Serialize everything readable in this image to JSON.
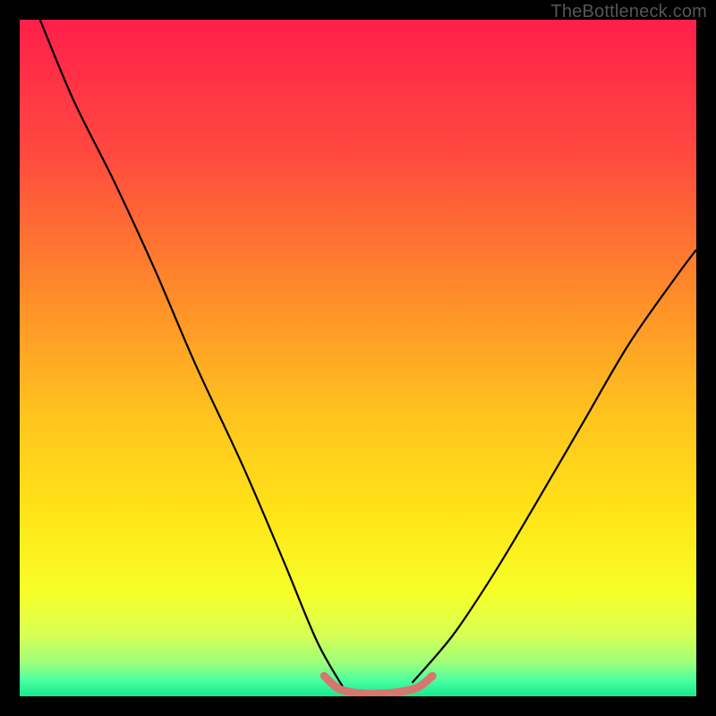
{
  "watermark": "TheBottleneck.com",
  "chart_data": {
    "type": "line",
    "title": "",
    "xlabel": "",
    "ylabel": "",
    "xlim": [
      0,
      100
    ],
    "ylim": [
      0,
      100
    ],
    "series": [
      {
        "name": "left-curve",
        "x": [
          3,
          8,
          14,
          20,
          26,
          33,
          39,
          44,
          48
        ],
        "values": [
          100,
          88,
          76,
          63,
          49,
          34,
          20,
          8,
          1
        ]
      },
      {
        "name": "right-curve",
        "x": [
          58,
          64,
          70,
          76,
          83,
          90,
          97,
          100
        ],
        "values": [
          2,
          9,
          18,
          28,
          40,
          52,
          62,
          66
        ]
      },
      {
        "name": "bottom-band-outline",
        "x": [
          45,
          47,
          49,
          51,
          53,
          55,
          57,
          59,
          61
        ],
        "values": [
          3,
          1.2,
          0.6,
          0.4,
          0.4,
          0.5,
          0.8,
          1.4,
          3
        ]
      }
    ],
    "legend": null,
    "grid": false
  },
  "gradient_stops": [
    {
      "offset": 0.0,
      "color": "#ff1f4a"
    },
    {
      "offset": 0.2,
      "color": "#ff4a3f"
    },
    {
      "offset": 0.4,
      "color": "#ff8a2a"
    },
    {
      "offset": 0.58,
      "color": "#ffc21e"
    },
    {
      "offset": 0.74,
      "color": "#ffe617"
    },
    {
      "offset": 0.85,
      "color": "#f6ff2a"
    },
    {
      "offset": 0.91,
      "color": "#d6ff55"
    },
    {
      "offset": 0.95,
      "color": "#9dff7a"
    },
    {
      "offset": 0.976,
      "color": "#4dffa0"
    },
    {
      "offset": 1.0,
      "color": "#17e88f"
    }
  ],
  "bottom_band_color": "#d5776e"
}
